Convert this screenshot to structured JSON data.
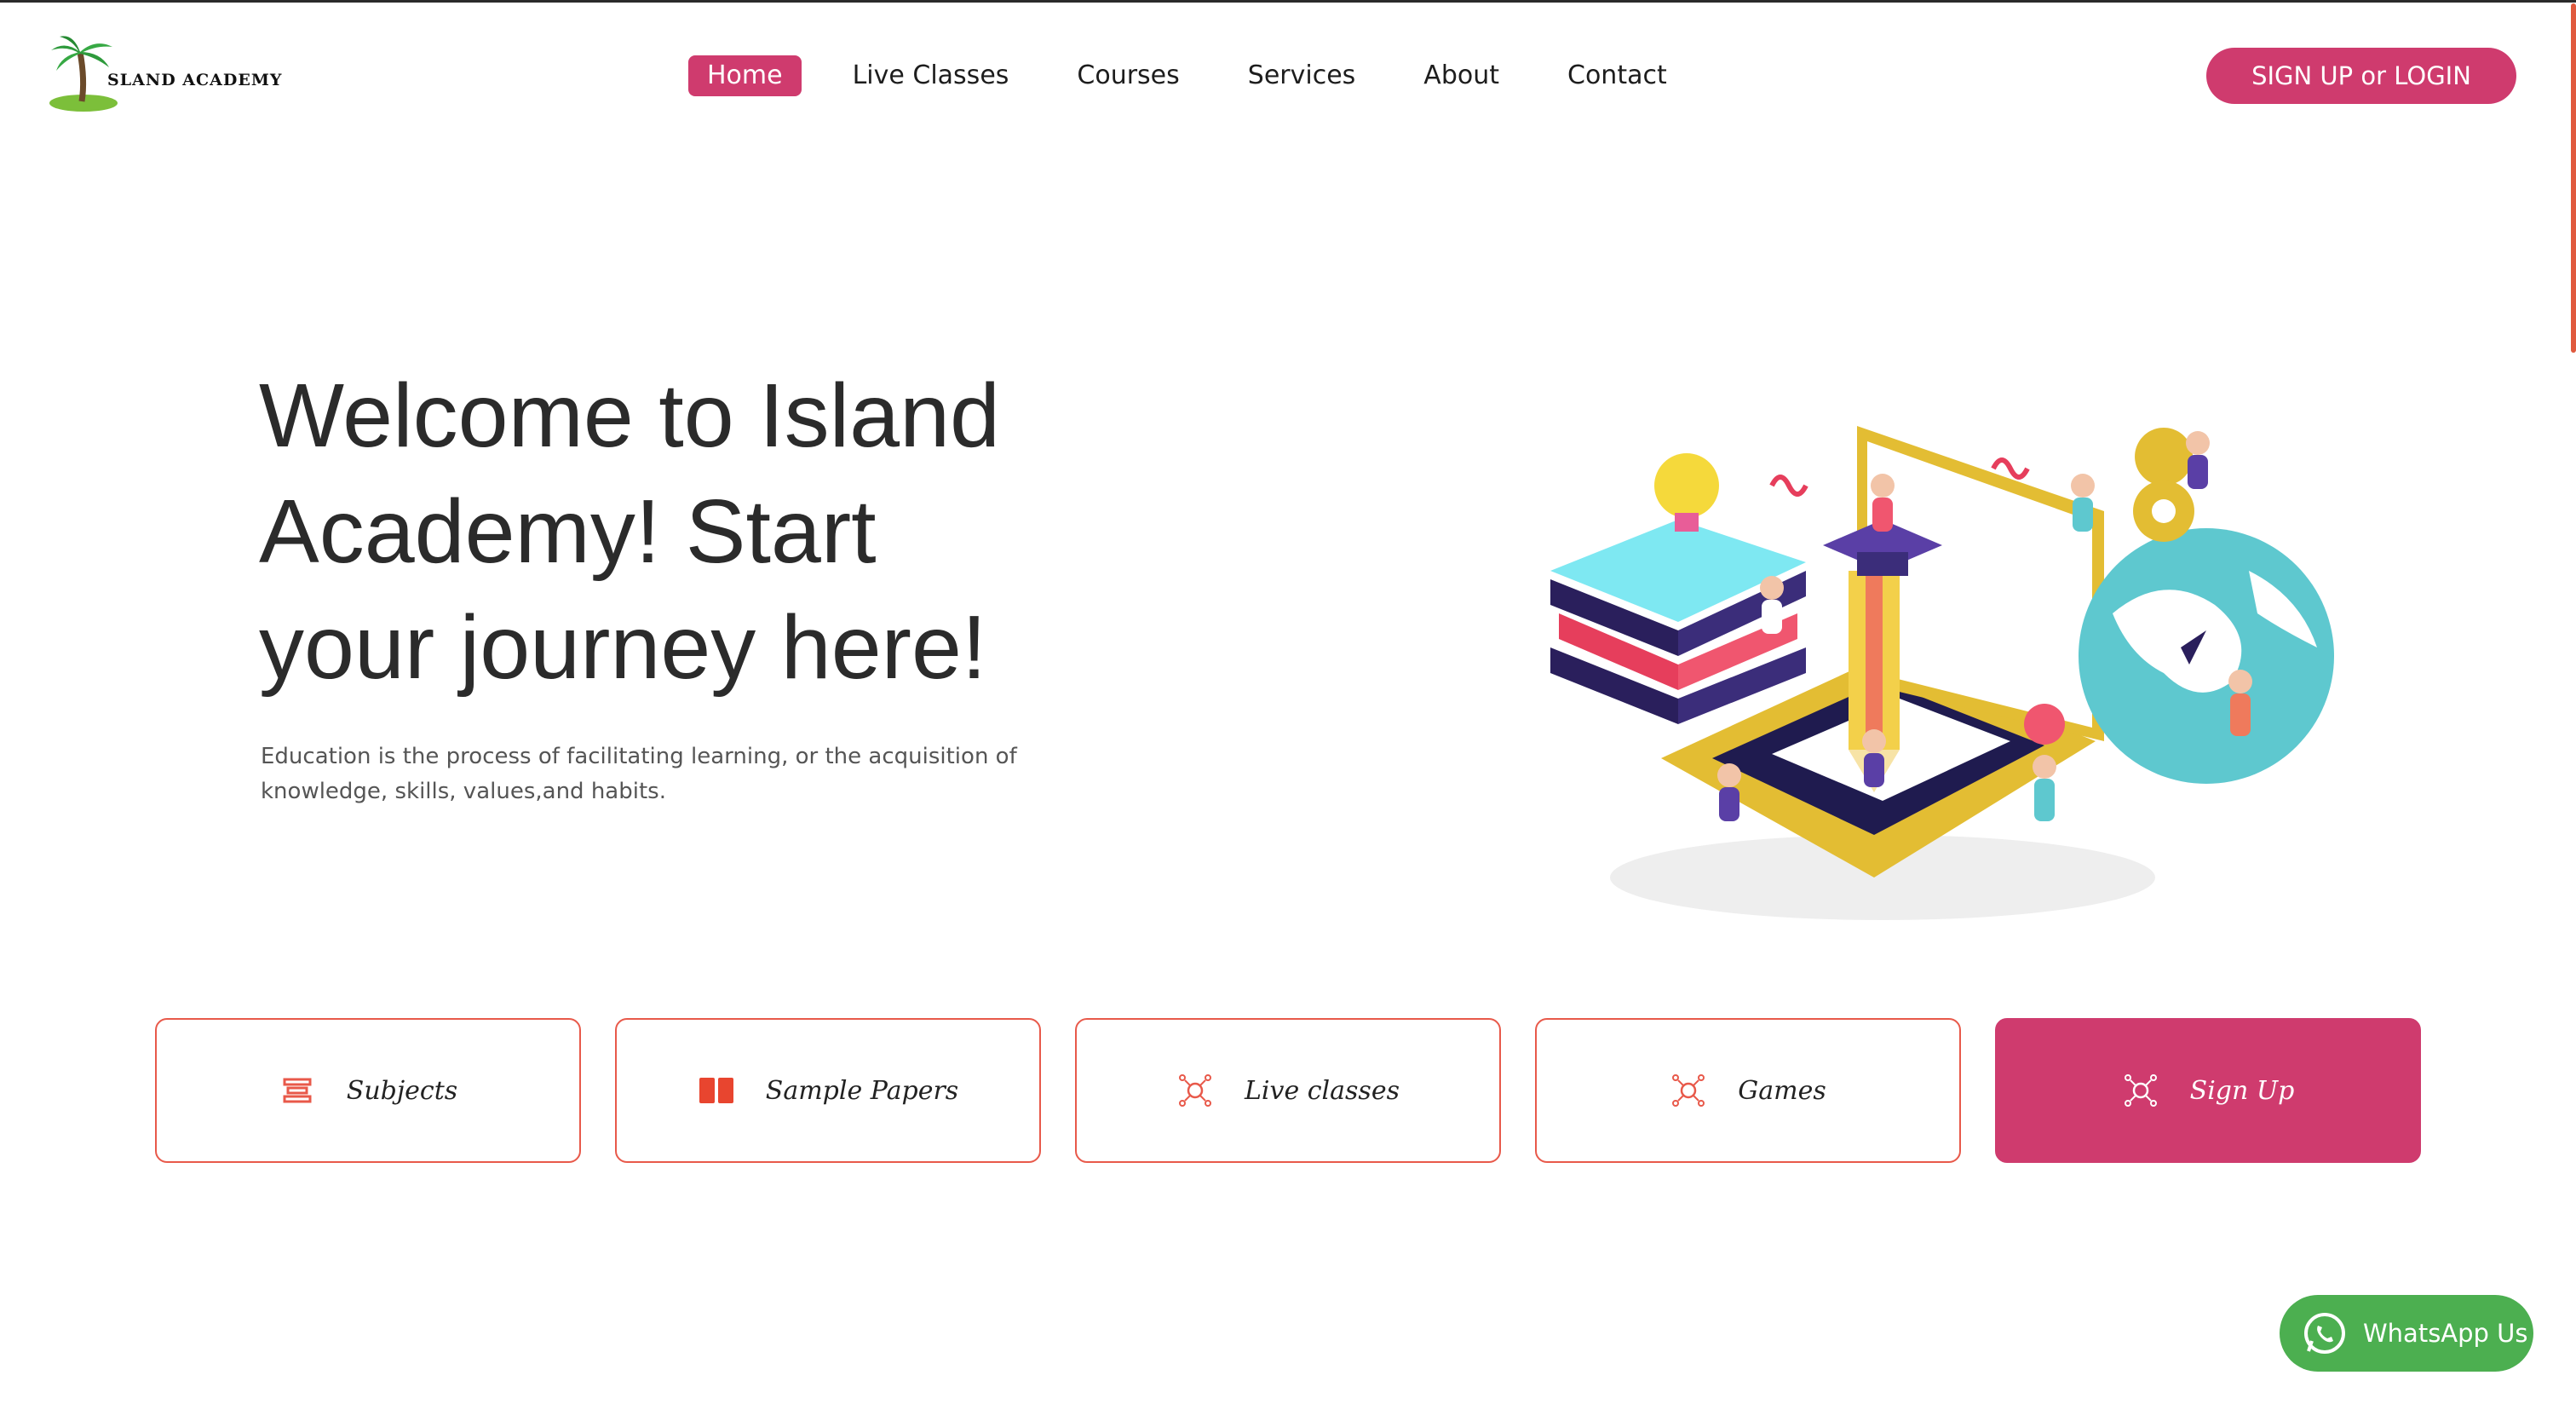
{
  "brand": {
    "logo_text": "SLAND ACADEMY"
  },
  "nav": {
    "items": [
      {
        "label": "Home",
        "active": true
      },
      {
        "label": "Live Classes",
        "active": false
      },
      {
        "label": "Courses",
        "active": false
      },
      {
        "label": "Services",
        "active": false
      },
      {
        "label": "About",
        "active": false
      },
      {
        "label": "Contact",
        "active": false
      }
    ],
    "signup_label": "SIGN UP or LOGIN"
  },
  "hero": {
    "title": "Welcome to Island Academy! Start your journey here!",
    "subtitle": "Education is the process of facilitating learning, or the acquisition of knowledge, skills, values,and habits."
  },
  "cards": [
    {
      "label": "Subjects",
      "icon": "subjects-icon"
    },
    {
      "label": "Sample Papers",
      "icon": "book-icon"
    },
    {
      "label": "Live classes",
      "icon": "network-icon"
    },
    {
      "label": "Games",
      "icon": "network-icon"
    },
    {
      "label": "Sign Up",
      "icon": "network-icon"
    }
  ],
  "whatsapp": {
    "label": "WhatsApp Us"
  },
  "colors": {
    "accent": "#cf3b6e",
    "card_border": "#e8594a",
    "whatsapp": "#4caf50",
    "scroll": "#e05a3e"
  }
}
